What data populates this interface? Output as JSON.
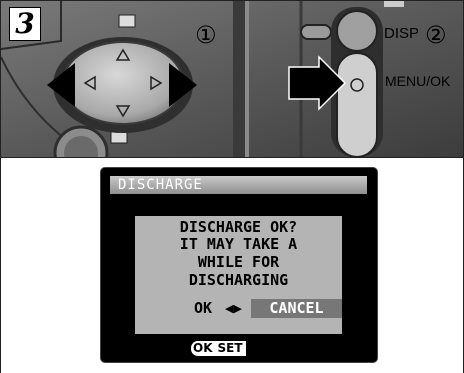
{
  "step": {
    "number": "3"
  },
  "callouts": {
    "one": "①",
    "two": "②"
  },
  "camera": {
    "disp_label": "DISP",
    "menu_ok_label": "MENU/OK"
  },
  "dialog": {
    "title": "DISCHARGE",
    "message_lines": [
      "DISCHARGE OK?",
      "IT MAY TAKE A",
      "WHILE FOR",
      "DISCHARGING"
    ],
    "ok_option": "OK",
    "toggle_arrows": "◀▶",
    "cancel_option": "CANCEL",
    "hint_ok": "OK",
    "hint_set": "SET"
  }
}
